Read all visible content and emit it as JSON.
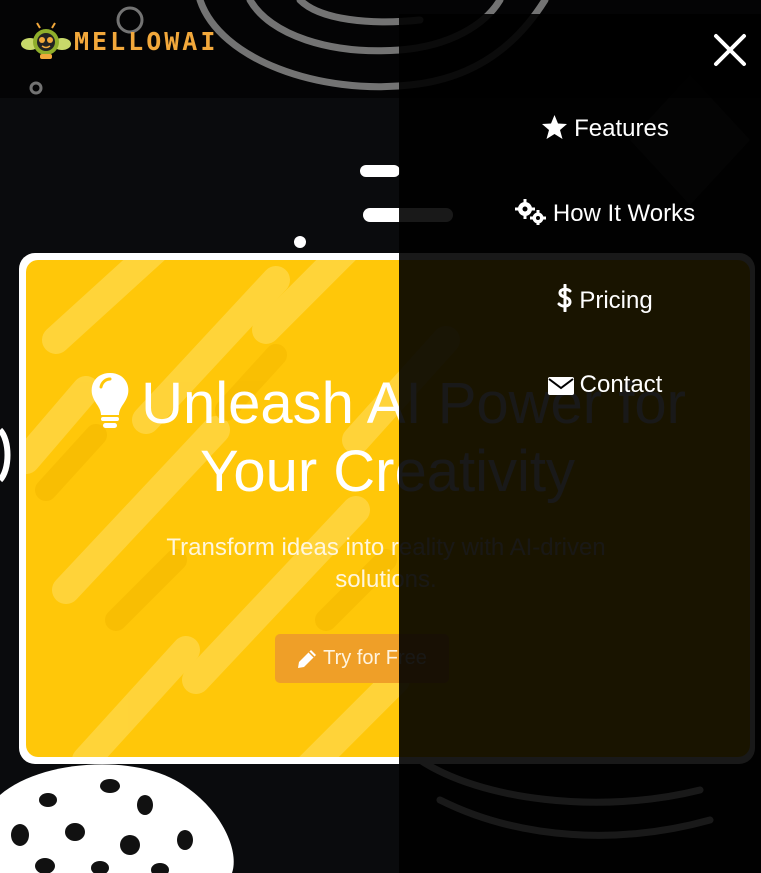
{
  "brand": {
    "name": "MELLOWAI",
    "logo_icon": "robot-bee-icon",
    "color": "#f2a83b"
  },
  "nav": {
    "close_icon": "close-icon",
    "items": [
      {
        "label": "Features",
        "icon": "star-icon"
      },
      {
        "label": "How It Works",
        "icon": "gears-icon"
      },
      {
        "label": "Pricing",
        "icon": "dollar-icon"
      },
      {
        "label": "Contact",
        "icon": "envelope-icon"
      }
    ]
  },
  "hero": {
    "title_line1": "Unleash AI Power for",
    "title_line2": "Your Creativity",
    "title_icon": "lightbulb-icon",
    "subtitle": "Transform ideas into reality with AI-driven solutions.",
    "cta_label": "Try for Free",
    "cta_icon": "pencil-icon",
    "accent": "#ffc709",
    "button_color": "#ef9f28"
  }
}
